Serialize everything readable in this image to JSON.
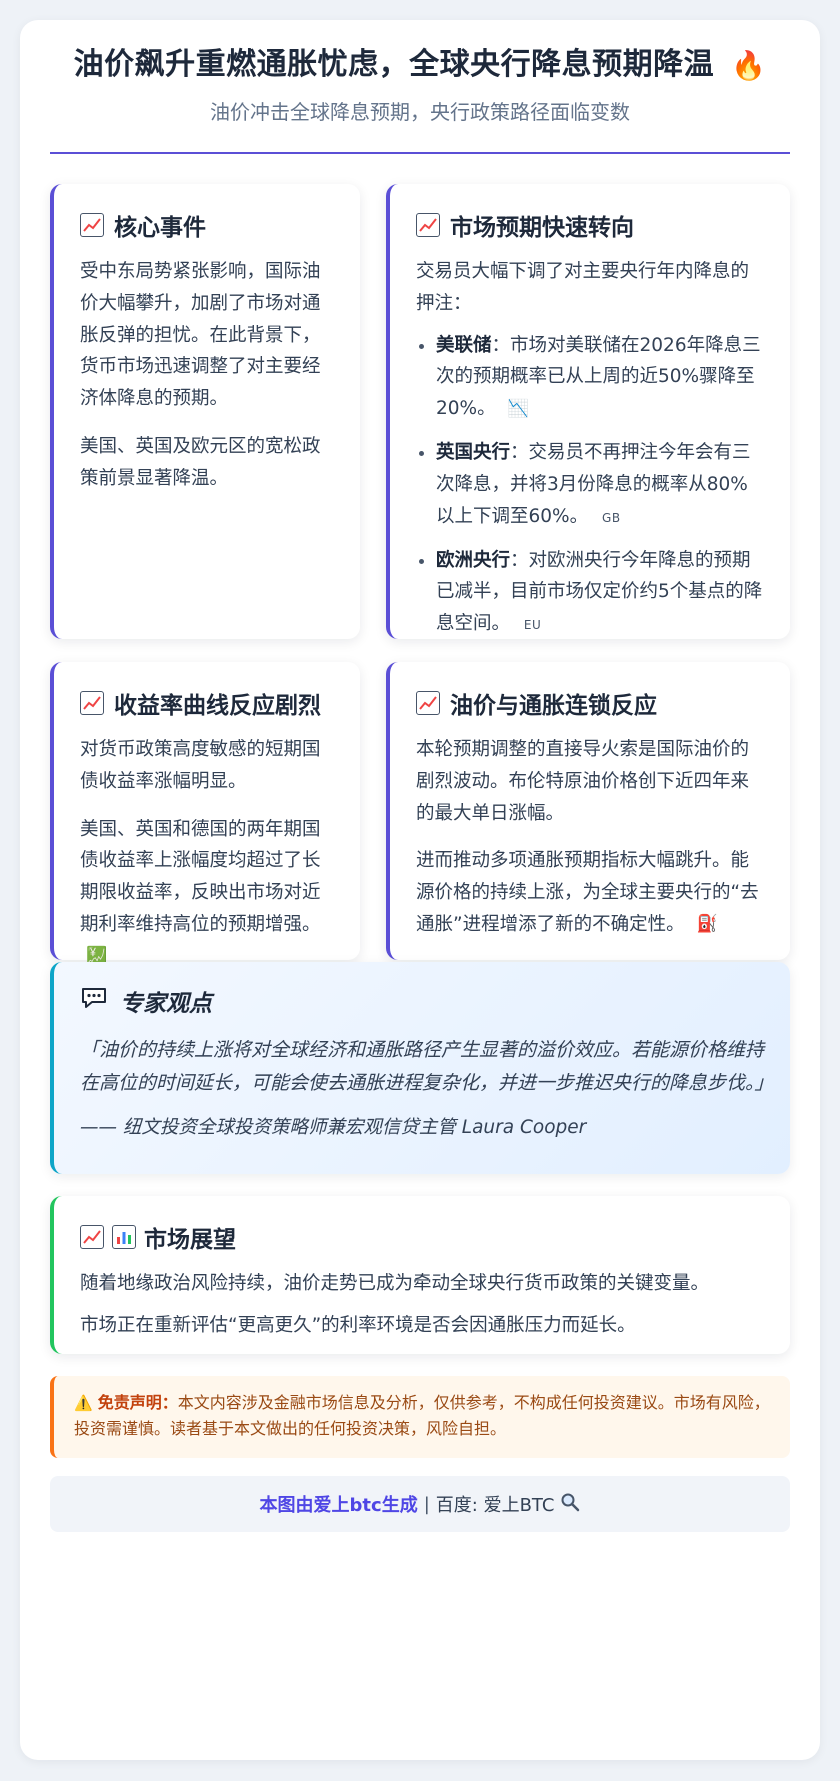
{
  "header": {
    "title": "油价飙升重燃通胀忧虑，全球央行降息预期降温",
    "title_icon": "fire-icon",
    "subtitle": "油价冲击全球降息预期，央行政策路径面临变数"
  },
  "cards": {
    "core_event": {
      "icon": "chart-up-icon",
      "heading": "核心事件",
      "paragraphs": [
        "受中东局势紧张影响，国际油价大幅攀升，加剧了市场对通胀反弹的担忧。在此背景下，货币市场迅速调整了对主要经济体降息的预期。",
        "美国、英国及欧元区的宽松政策前景显著降温。"
      ]
    },
    "market_shift": {
      "icon": "chart-up-icon",
      "heading": "市场预期快速转向",
      "intro": "交易员大幅下调了对主要央行年内降息的押注：",
      "items": [
        {
          "name": "美联储",
          "text": "：市场对美联储在2026年降息三次的预期概率已从上周的近50%骤降至20%。",
          "tag": "📉"
        },
        {
          "name": "英国央行",
          "text": "：交易员不再押注今年会有三次降息，并将3月份降息的概率从80%以上下调至60%。",
          "tag": "GB"
        },
        {
          "name": "欧洲央行",
          "text": "：对欧洲央行今年降息的预期已减半，目前市场仅定价约5个基点的降息空间。",
          "tag": "EU"
        }
      ]
    },
    "yield_curve": {
      "icon": "chart-up-icon",
      "heading": "收益率曲线反应剧烈",
      "paragraphs": [
        "对货币政策高度敏感的短期国债收益率涨幅明显。",
        "美国、英国和德国的两年期国债收益率上涨幅度均超过了长期限收益率，反映出市场对近期利率维持高位的预期增强。"
      ],
      "end_icon": "💹"
    },
    "oil_inflation": {
      "icon": "chart-up-icon",
      "heading": "油价与通胀连锁反应",
      "paragraphs": [
        "本轮预期调整的直接导火索是国际油价的剧烈波动。布伦特原油价格创下近四年来的最大单日涨幅。",
        "进而推动多项通胀预期指标大幅跳升。能源价格的持续上涨，为全球主要央行的“去通胀”进程增添了新的不确定性。"
      ],
      "end_icon": "⛽"
    }
  },
  "expert": {
    "icon": "speech-bubble-icon",
    "heading": "专家观点",
    "quote": "「油价的持续上涨将对全球经济和通胀路径产生显著的溢价效应。若能源价格维持在高位的时间延长，可能会使去通胀进程复杂化，并进一步推迟央行的降息步伐。」",
    "author": "—— 纽文投资全球投资策略师兼宏观信贷主管 Laura Cooper"
  },
  "outlook": {
    "icons": [
      "chart-up-icon",
      "bar-chart-icon"
    ],
    "heading": "市场展望",
    "paragraphs": [
      "随着地缘政治风险持续，油价走势已成为牵动全球央行货币政策的关键变量。",
      "市场正在重新评估“更高更久”的利率环境是否会因通胀压力而延长。"
    ]
  },
  "disclaimer": {
    "icon": "warning-icon",
    "label": "免责声明：",
    "text": "本文内容涉及金融市场信息及分析，仅供参考，不构成任何投资建议。市场有风险，投资需谨慎。读者基于本文做出的任何投资决策，风险自担。"
  },
  "footer": {
    "brand": "本图由爱上btc生成",
    "separator": "|",
    "text": "百度: 爱上BTC",
    "icon": "magnifier-icon"
  },
  "colors": {
    "accent": "#5b4fd6",
    "expert_accent": "#0ea5c8",
    "outlook_accent": "#22c55e",
    "warning_accent": "#f97316",
    "chart_red": "#ef4444"
  }
}
